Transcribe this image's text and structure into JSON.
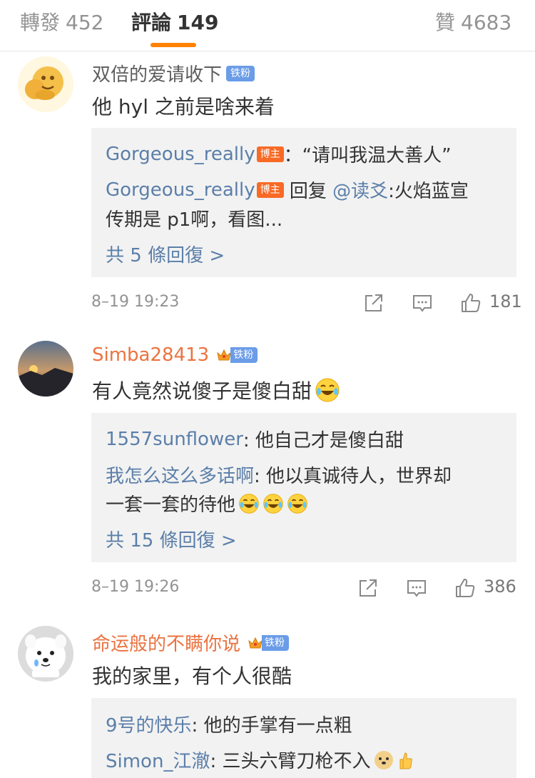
{
  "tabs": [
    {
      "label": "轉發",
      "count": "452"
    },
    {
      "label": "評論",
      "count": "149"
    },
    {
      "label": "贊",
      "count": "4683"
    }
  ],
  "colors": {
    "accent": "#ff8200",
    "link": "#5b7fa9",
    "orange_name": "#eb7340",
    "fan_badge": "#6a9ce8",
    "blogger_badge": "#f96a25"
  },
  "comments": [
    {
      "username": "双倍的爱请收下",
      "badge": "铁粉",
      "text": "他 hyl 之前是啥来着",
      "replies": [
        {
          "name": "Gorgeous_really",
          "badge": "博主",
          "text": "：“请叫我温大善人”"
        },
        {
          "name": "Gorgeous_really",
          "badge": "博主",
          "text": " 回复 ",
          "mention": "@读爻",
          "text2": ":火焰蓝宣",
          "text3": "传期是 p1啊，看图..."
        }
      ],
      "more": "共 5 條回復 >",
      "time": "8–19 19:23",
      "likes": "181"
    },
    {
      "username": "Simba28413",
      "badge": "铁粉",
      "text": "有人竟然说傻子是傻白甜",
      "replies": [
        {
          "name": "1557sunflower",
          "text": ": 他自己才是傻白甜"
        },
        {
          "name": "我怎么这么多话啊",
          "text": ": 他以真诚待人，世界却",
          "text2": "一套一套的待他"
        }
      ],
      "more": "共 15 條回復 >",
      "time": "8–19 19:26",
      "likes": "386"
    },
    {
      "username": "命运般的不瞒你说",
      "badge": "铁粉",
      "text": "我的家里，有个人很酷",
      "replies": [
        {
          "name": "9号的快乐",
          "text": ": 他的手掌有一点粗"
        },
        {
          "name": "Simon_江澈",
          "text": ": 三头六臂刀枪不入"
        }
      ]
    }
  ],
  "icons": {
    "share": "share-icon",
    "comment": "comment-icon",
    "like": "thumbs-up-icon",
    "crown": "crown-icon",
    "laugh": "laugh-cry-emoji"
  }
}
